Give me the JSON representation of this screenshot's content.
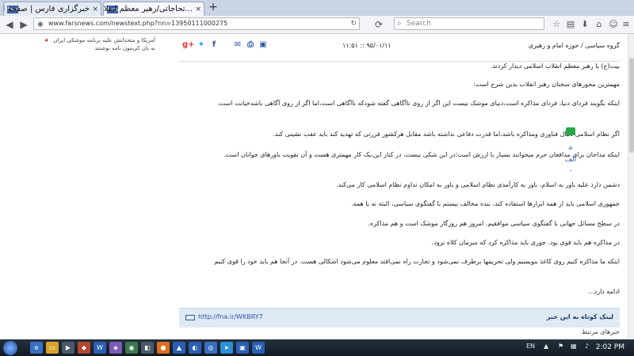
{
  "browser": {
    "tabs": [
      {
        "title": "خبرگزاری فارس | صفحه ا...",
        "favicon": "fars-icon",
        "active": false
      },
      {
        "title": "...تحاجاتی/رهبر معظم انقلاب ع",
        "favicon": "fars-icon",
        "active": true
      }
    ],
    "new_tab": "+",
    "url": "www.farsnews.com/newstext.php?nn=13950111000275",
    "search_placeholder": "Search"
  },
  "sidebar_teaser": {
    "text": "آمریکا و متحدانش علیه برنامه موشکی ایران به بان کی‌مون نامه نوشتند"
  },
  "article": {
    "breadcrumb": "گروه سیاسی / حوزه امام و رهبری",
    "datetime": "۹۵/۰۱/۱۱ :: ۱۱:۵۱",
    "share_icons": [
      "google-plus-icon",
      "twitter-icon",
      "facebook-icon",
      "email-icon",
      "print-icon",
      "save-icon"
    ],
    "paragraphs": [
      "بیت(ع) با رهبر معظم انقلاب اسلامی دیدار کردند.",
      "مهمترین محورهای سخنان رهبر انقلاب بدین شرح است:",
      "اینکه بگویند فردای دنیا، فردای مذاکره است،دنیای موشک نیست این اگر از روی ناآگاهی گفته شودکه ناآگاهی است،اما اگر از روی آگاهی باشدخیانت است.",
      "اگر نظام اسلامی دنبال فناوری ومذاکره باشد،اما قدرت دفاعی نداشته باشد مقابل هرکشور فزرتی که تهدید کند باید عقب نشینی کند.",
      "اینکه مداحان برای مدافعان حرم میخوانند بسیار با ارزش است؛در این شکی نیست، در کنار این،یک کار مهمتری هست و آن تقویت باورهای جوانان است.",
      "دشمن دارد علیه باور به اسلام، باور به کارآمدی نظام اسلامی و باور به امکان تداوم نظام اسلامی کار می‌کند.",
      "جمهوری اسلامی باید از همه ابزارها استفاده کند، بنده مخالف نیستم با گفتگوی سیاسی، البته نه با همه.",
      "در سطح مسائل جهانی با گفتگوی سیاسی موافقیم. امروز هم روزگار موشک است و هم مذاکره.",
      "در مذاکره هم باید قوی بود. جوری باید مذاکره کرد که سرمان کلاه نرود.",
      "اینکه ما مذاکره کنیم روی کاغذ بنویسیم ولی تحریمها برطرف نمی‌شود و تجارت راه نمی‌افتد معلوم می‌شود اشکالی هست. در آنجا هم باید خود را قوی کنیم",
      "ادامه دارد..."
    ],
    "short_link_label": "لینک کوتاه به این خبر",
    "short_link_url": "http://fna.ir/WKBRY7",
    "next_line": "خبرهای مرتبط"
  },
  "right_tools": {
    "items": [
      "+",
      "الف",
      "-"
    ]
  },
  "taskbar": {
    "language": "EN",
    "clock": "2:02 PM"
  }
}
